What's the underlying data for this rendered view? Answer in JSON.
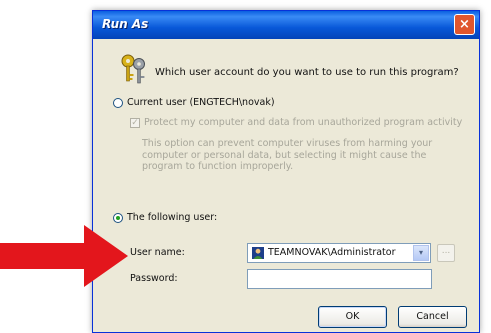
{
  "dialog": {
    "title": "Run As",
    "close_label": "×",
    "prompt": "Which user account do you want to use to run this program?",
    "current_user_label": "Current user (ENGTECH\\novak)",
    "protect_label": "Protect my computer and data from unauthorized program activity",
    "info_text": "This option can prevent computer viruses from harming your computer or personal data, but selecting it might cause the program to function improperly.",
    "following_user_label": "The following user:",
    "user_name_label": "User name:",
    "user_name_value": "TEAMNOVAK\\Administrator",
    "password_label": "Password:",
    "password_value": "",
    "browse_label": "...",
    "dropdown_label": "▾",
    "ok_label": "OK",
    "cancel_label": "Cancel",
    "selected_option": "following_user",
    "protect_checked": true,
    "protect_enabled": false
  },
  "icons": {
    "title_close": "close-icon",
    "keys": "keys-icon",
    "user": "user-account-icon",
    "annotation": "red-arrow-icon"
  },
  "colors": {
    "titlebar": "#0858d8",
    "dialog_bg": "#ece9d8",
    "close_button": "#e0562e",
    "arrow": "#e3161c",
    "disabled_text": "#a7a69a"
  }
}
